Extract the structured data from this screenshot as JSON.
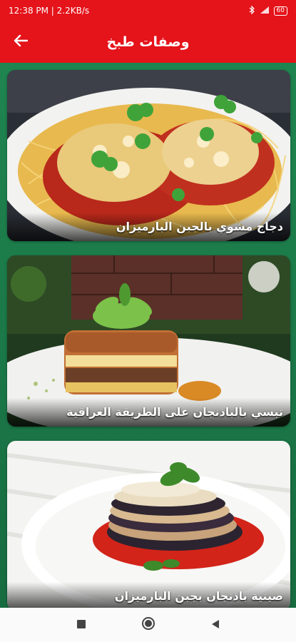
{
  "status_bar": {
    "time_speed": "12:38 PM | 2.2KB/s",
    "battery": "60",
    "icons": [
      "bluetooth-icon",
      "signal-icon",
      "battery-icon"
    ]
  },
  "app_bar": {
    "title": "وصفات طبخ",
    "back_icon": "arrow-left-icon"
  },
  "recipes": [
    {
      "title": "دجاج مشوي بالجبن البارميزان",
      "image": "chicken-parmesan-spaghetti"
    },
    {
      "title": "تبسي بالباذنجان على الطريقة العراقية",
      "image": "eggplant-tower-basil"
    },
    {
      "title": "صينية باذنجان بجبن البارميزان",
      "image": "eggplant-parmesan-stack"
    }
  ],
  "nav_bar": {
    "icons": [
      "square-icon",
      "circle-icon",
      "triangle-back-icon"
    ]
  },
  "colors": {
    "primary": "#e5131a",
    "background": "#1b7a48"
  }
}
